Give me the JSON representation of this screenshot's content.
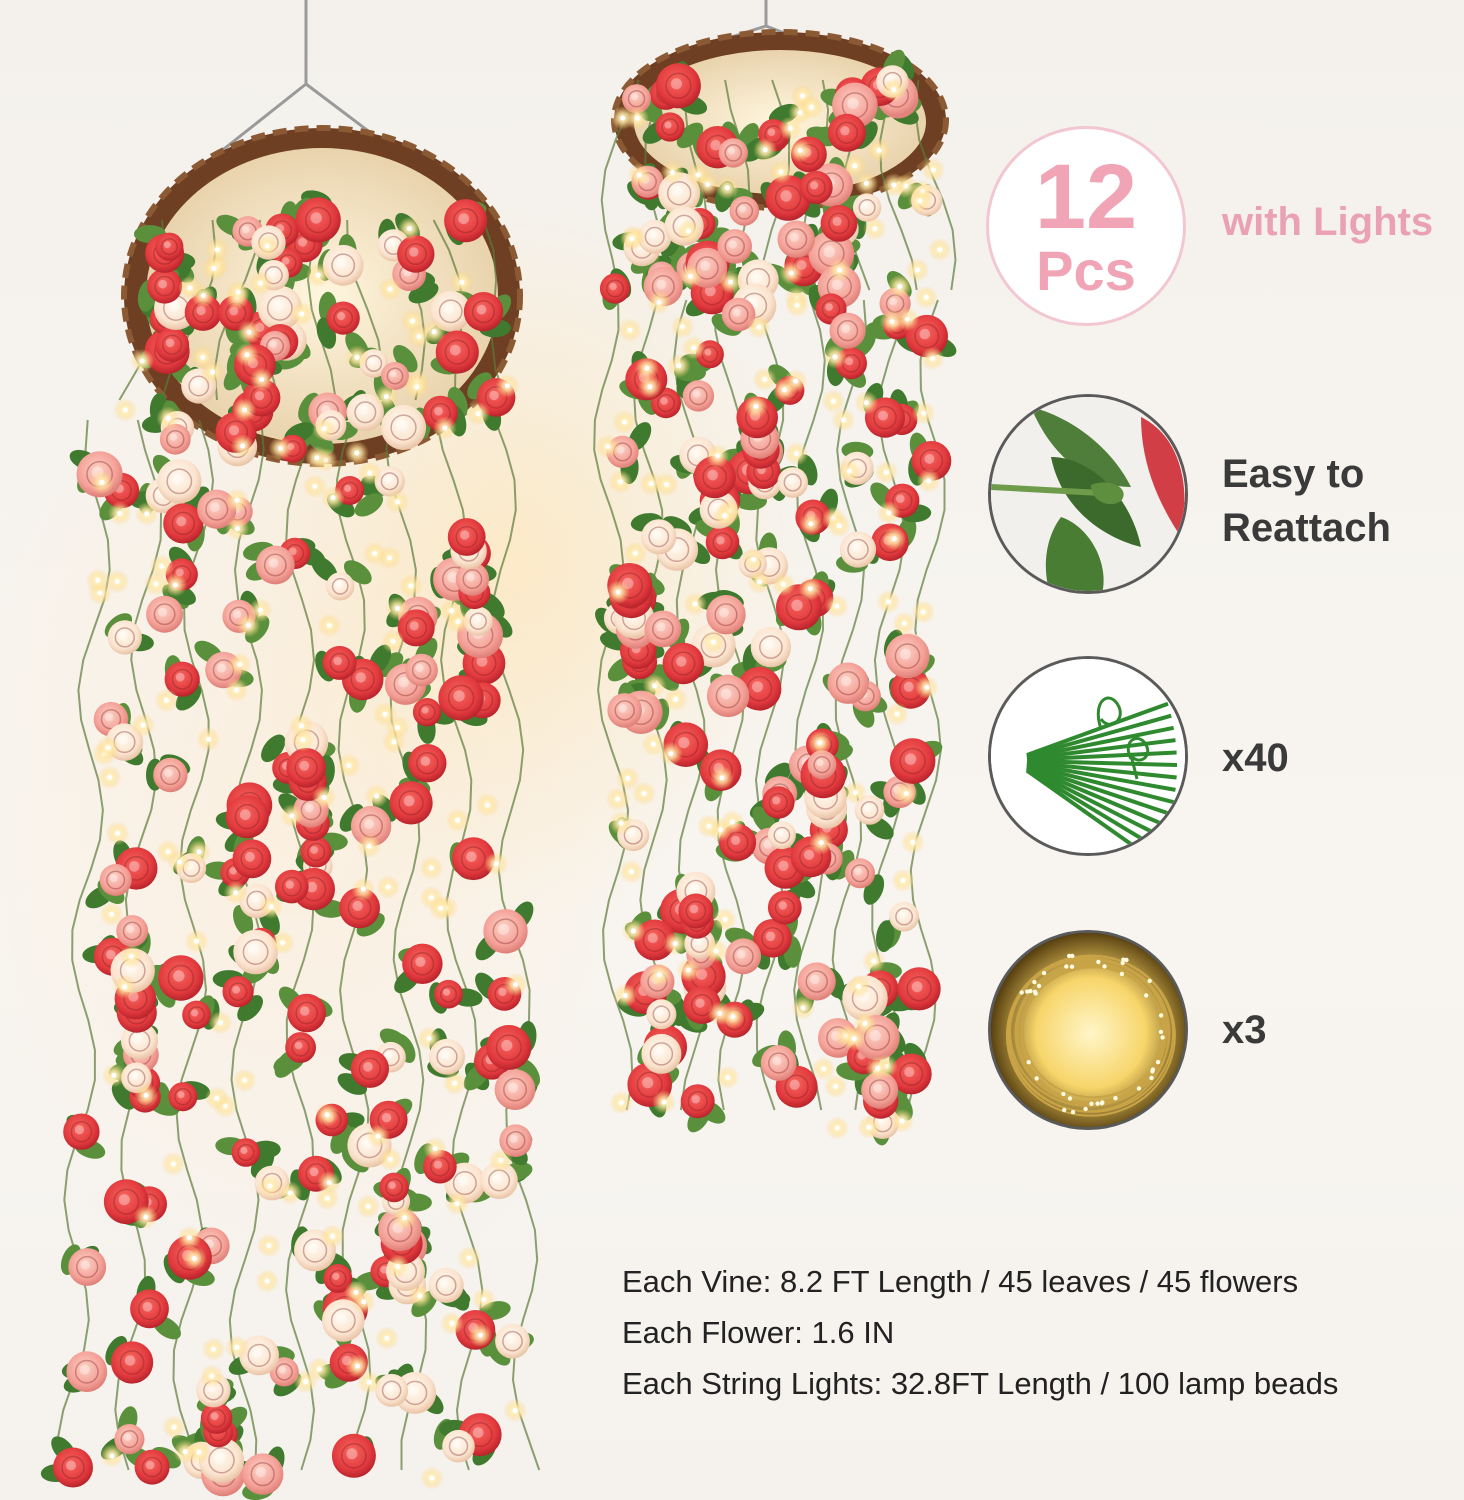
{
  "badge": {
    "number": "12",
    "unit": "Pcs"
  },
  "tagline": "with Lights",
  "features": {
    "reattach_line1": "Easy to",
    "reattach_line2": "Reattach",
    "ties_count": "x40",
    "lights_count": "x3"
  },
  "specs": [
    "Each Vine: 8.2 FT Length / 45 leaves / 45 flowers",
    "Each Flower: 1.6 IN",
    "Each String Lights: 32.8FT Length / 100 lamp beads"
  ],
  "colors": {
    "accent_pink": "#f0a4b6",
    "rose_red": "#e8333c",
    "rose_pink": "#f6a7a0",
    "rose_cream": "#fbe2cf",
    "leaf_green": "#3f7a2e",
    "basket_brown": "#7a4a2a",
    "light_glow": "#fff4c8"
  }
}
